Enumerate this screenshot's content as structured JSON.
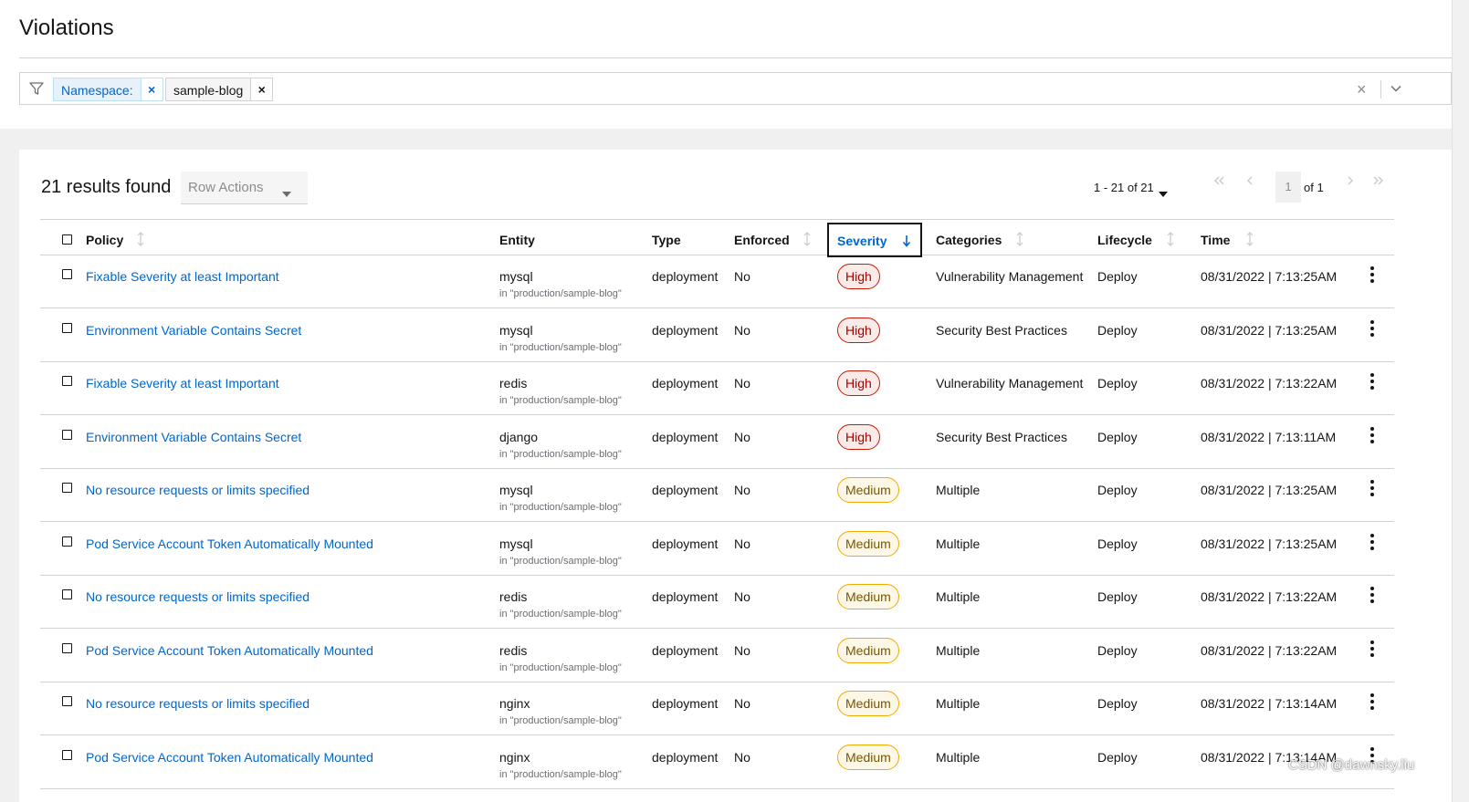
{
  "page": {
    "title": "Violations"
  },
  "filter": {
    "chip_key": "Namespace:",
    "chip_value": "sample-blog",
    "chip_remove": "×",
    "clear": "×"
  },
  "toolbar": {
    "results": "21 results found",
    "row_actions": "Row Actions",
    "pagination_range": "1 - 21 of 21",
    "page": "1",
    "of_pages": "of 1"
  },
  "table": {
    "columns": {
      "policy": "Policy",
      "entity": "Entity",
      "type": "Type",
      "enforced": "Enforced",
      "severity": "Severity",
      "categories": "Categories",
      "lifecycle": "Lifecycle",
      "time": "Time"
    },
    "rows": [
      {
        "policy": "Fixable Severity at least Important",
        "entity": "mysql",
        "entity_ns": "in \"production/sample-blog\"",
        "type": "deployment",
        "enforced": "No",
        "severity": "High",
        "categories": "Vulnerability Management",
        "lifecycle": "Deploy",
        "time": "08/31/2022 | 7:13:25AM"
      },
      {
        "policy": "Environment Variable Contains Secret",
        "entity": "mysql",
        "entity_ns": "in \"production/sample-blog\"",
        "type": "deployment",
        "enforced": "No",
        "severity": "High",
        "categories": "Security Best Practices",
        "lifecycle": "Deploy",
        "time": "08/31/2022 | 7:13:25AM"
      },
      {
        "policy": "Fixable Severity at least Important",
        "entity": "redis",
        "entity_ns": "in \"production/sample-blog\"",
        "type": "deployment",
        "enforced": "No",
        "severity": "High",
        "categories": "Vulnerability Management",
        "lifecycle": "Deploy",
        "time": "08/31/2022 | 7:13:22AM"
      },
      {
        "policy": "Environment Variable Contains Secret",
        "entity": "django",
        "entity_ns": "in \"production/sample-blog\"",
        "type": "deployment",
        "enforced": "No",
        "severity": "High",
        "categories": "Security Best Practices",
        "lifecycle": "Deploy",
        "time": "08/31/2022 | 7:13:11AM"
      },
      {
        "policy": "No resource requests or limits specified",
        "entity": "mysql",
        "entity_ns": "in \"production/sample-blog\"",
        "type": "deployment",
        "enforced": "No",
        "severity": "Medium",
        "categories": "Multiple",
        "lifecycle": "Deploy",
        "time": "08/31/2022 | 7:13:25AM"
      },
      {
        "policy": "Pod Service Account Token Automatically Mounted",
        "entity": "mysql",
        "entity_ns": "in \"production/sample-blog\"",
        "type": "deployment",
        "enforced": "No",
        "severity": "Medium",
        "categories": "Multiple",
        "lifecycle": "Deploy",
        "time": "08/31/2022 | 7:13:25AM"
      },
      {
        "policy": "No resource requests or limits specified",
        "entity": "redis",
        "entity_ns": "in \"production/sample-blog\"",
        "type": "deployment",
        "enforced": "No",
        "severity": "Medium",
        "categories": "Multiple",
        "lifecycle": "Deploy",
        "time": "08/31/2022 | 7:13:22AM"
      },
      {
        "policy": "Pod Service Account Token Automatically Mounted",
        "entity": "redis",
        "entity_ns": "in \"production/sample-blog\"",
        "type": "deployment",
        "enforced": "No",
        "severity": "Medium",
        "categories": "Multiple",
        "lifecycle": "Deploy",
        "time": "08/31/2022 | 7:13:22AM"
      },
      {
        "policy": "No resource requests or limits specified",
        "entity": "nginx",
        "entity_ns": "in \"production/sample-blog\"",
        "type": "deployment",
        "enforced": "No",
        "severity": "Medium",
        "categories": "Multiple",
        "lifecycle": "Deploy",
        "time": "08/31/2022 | 7:13:14AM"
      },
      {
        "policy": "Pod Service Account Token Automatically Mounted",
        "entity": "nginx",
        "entity_ns": "in \"production/sample-blog\"",
        "type": "deployment",
        "enforced": "No",
        "severity": "Medium",
        "categories": "Multiple",
        "lifecycle": "Deploy",
        "time": "08/31/2022 | 7:13:14AM"
      }
    ]
  },
  "watermark": "CSDN @dawnsky.liu",
  "colors": {
    "link": "#0066cc",
    "high": "#c9190b",
    "medium": "#f0ab00"
  },
  "icons": [
    "filter-icon",
    "close-icon",
    "chevron-down-icon",
    "caret-down-icon",
    "sort-icon",
    "sort-down-icon",
    "first-page-icon",
    "previous-page-icon",
    "next-page-icon",
    "last-page-icon",
    "kebab-icon"
  ]
}
